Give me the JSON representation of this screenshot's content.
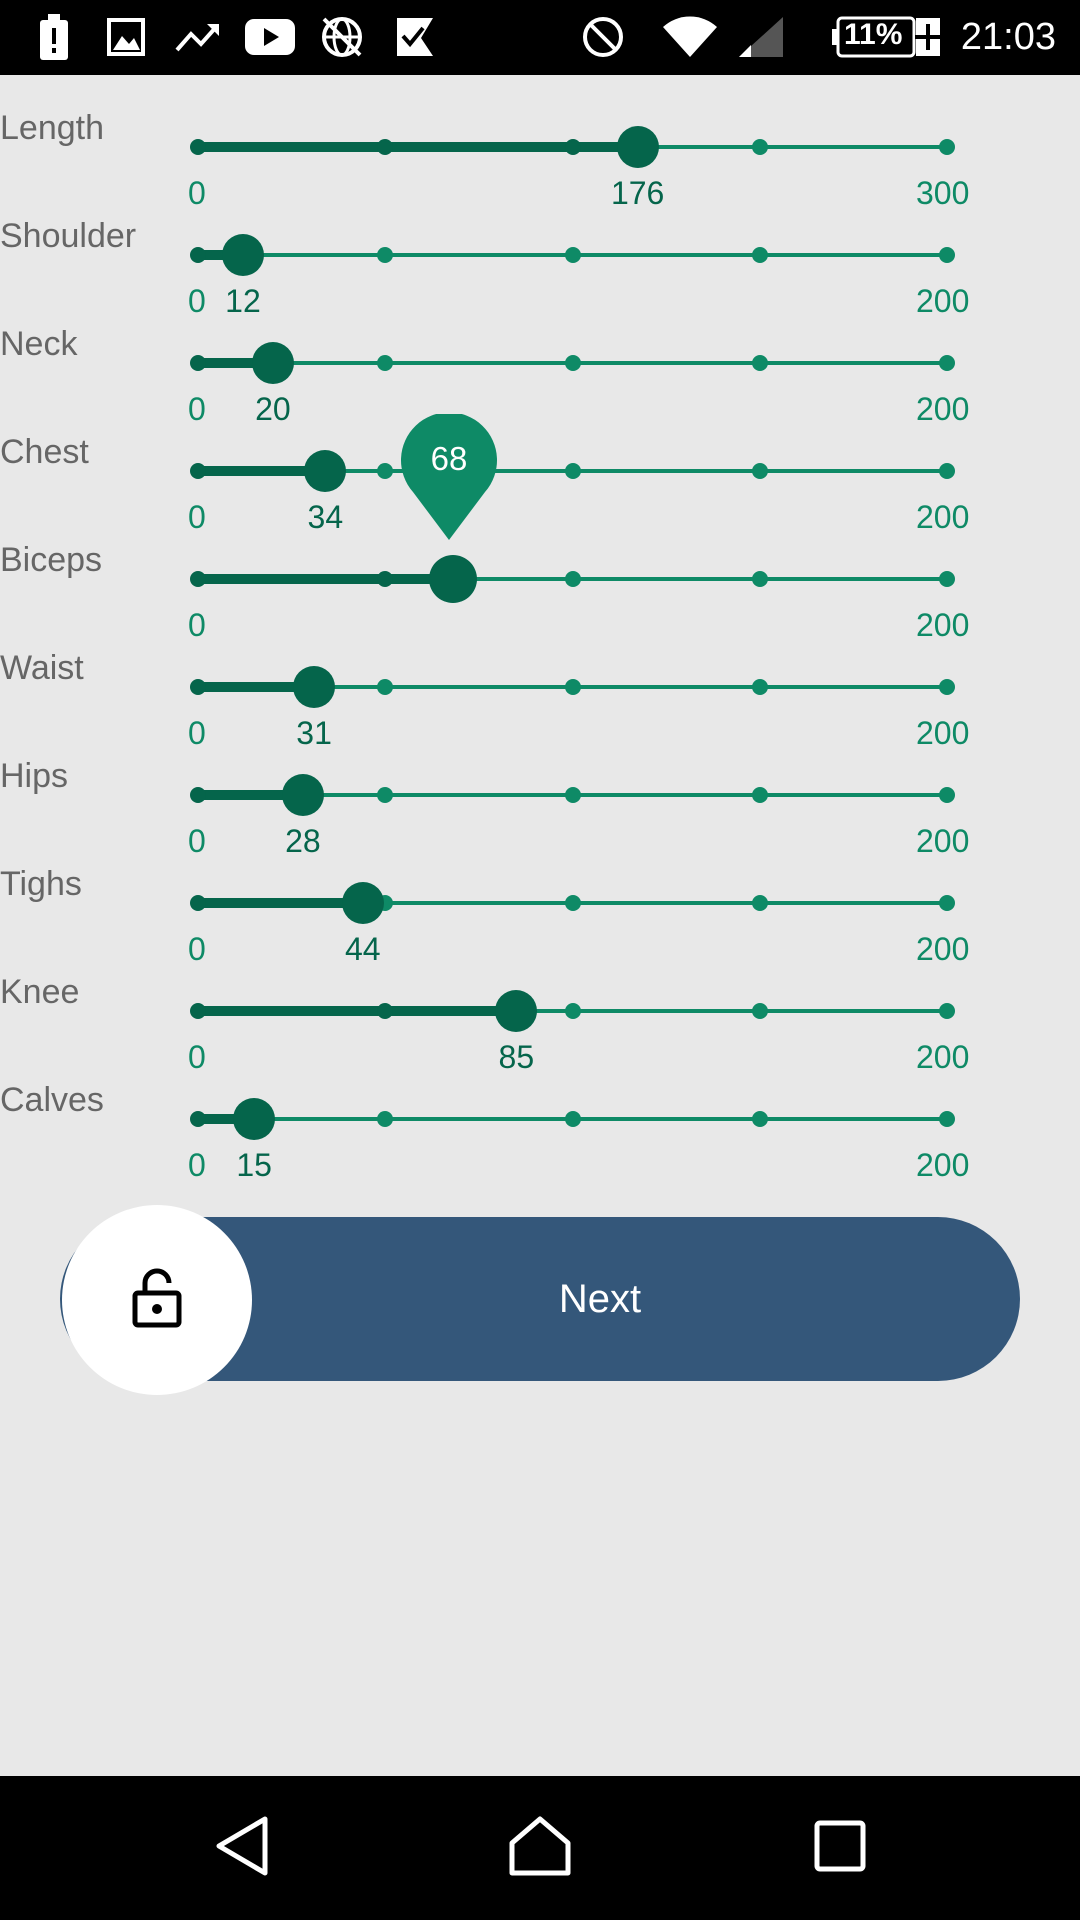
{
  "status_bar": {
    "icons": [
      "alert-icon",
      "image-icon",
      "trending-icon",
      "youtube-icon",
      "globe-off-icon",
      "check-flag-icon",
      "do-not-disturb-icon",
      "wifi-icon",
      "signal-icon",
      "battery-icon"
    ],
    "battery": "11%",
    "time": "21:03"
  },
  "sliders": [
    {
      "label": "Length",
      "min": "0",
      "max": "300",
      "value": "176",
      "fraction": 0.587
    },
    {
      "label": "Shoulder",
      "min": "0",
      "max": "200",
      "value": "12",
      "fraction": 0.06
    },
    {
      "label": "Neck",
      "min": "0",
      "max": "200",
      "value": "20",
      "fraction": 0.1
    },
    {
      "label": "Chest",
      "min": "0",
      "max": "200",
      "value": "34",
      "fraction": 0.17
    },
    {
      "label": "Biceps",
      "min": "0",
      "max": "200",
      "value": "68",
      "fraction": 0.34
    },
    {
      "label": "Waist",
      "min": "0",
      "max": "200",
      "value": "31",
      "fraction": 0.155
    },
    {
      "label": "Hips",
      "min": "0",
      "max": "200",
      "value": "28",
      "fraction": 0.14
    },
    {
      "label": "Tighs",
      "min": "0",
      "max": "200",
      "value": "44",
      "fraction": 0.22
    },
    {
      "label": "Knee",
      "min": "0",
      "max": "200",
      "value": "85",
      "fraction": 0.425
    },
    {
      "label": "Calves",
      "min": "0",
      "max": "200",
      "value": "15",
      "fraction": 0.075
    }
  ],
  "tooltip": {
    "value": "68"
  },
  "swipe_button": {
    "label": "Next",
    "icon": "unlock-icon"
  },
  "nav_bar": {
    "icons": [
      "back-icon",
      "home-icon",
      "recents-icon"
    ]
  },
  "colors": {
    "track": "#0e8a66",
    "fill": "#05654b",
    "button": "#34577a",
    "background": "#e8e8e8"
  }
}
